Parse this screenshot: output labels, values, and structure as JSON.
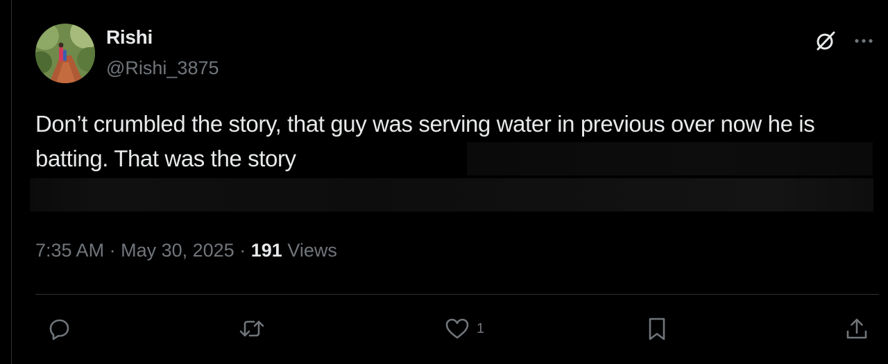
{
  "author": {
    "name": "Rishi",
    "handle": "@Rishi_3875"
  },
  "post": {
    "text": "Don’t crumbled the story, that guy was serving water in previous over now he is batting. That was the story",
    "time": "7:35 AM",
    "separator": "·",
    "date": "May 30, 2025",
    "views_count": "191",
    "views_label": "Views"
  },
  "actions": {
    "likes_count": "1"
  },
  "icons": {
    "header": [
      "grok-icon",
      "more-icon"
    ],
    "actions": [
      "reply-icon",
      "repost-icon",
      "like-icon",
      "bookmark-icon",
      "share-icon"
    ]
  },
  "colors": {
    "background": "#000000",
    "text_primary": "#e7e9ea",
    "text_secondary": "#71767b",
    "divider": "#2f3336"
  }
}
